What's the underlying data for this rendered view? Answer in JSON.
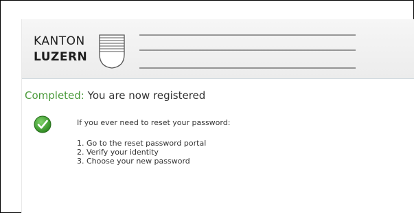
{
  "logo": {
    "line1": "KANTON",
    "line2": "LUZERN"
  },
  "status": {
    "label": "Completed:",
    "message": "You are now registered"
  },
  "instructions": {
    "intro": "If you ever need to reset your password:",
    "steps": [
      "1. Go to the reset password portal",
      "2. Verify your identity",
      "3. Choose your new password"
    ]
  },
  "colors": {
    "success": "#4a9a3a",
    "check_badge": "#3d9a2e"
  },
  "icons": {
    "status": "checkmark-circle-icon",
    "crest": "coat-of-arms-icon"
  }
}
